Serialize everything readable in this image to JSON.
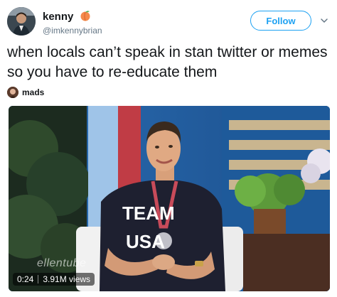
{
  "user": {
    "display_name": "kenny",
    "handle": "@imkennybrian"
  },
  "follow_label": "Follow",
  "tweet": {
    "text": "when locals can’t speak in stan twitter or memes so you have to re-educate them"
  },
  "quote": {
    "name": "mads"
  },
  "video": {
    "time": "0:24",
    "views": "3.91M views",
    "watermark": "ellentube",
    "shirt_text_top": "TEAM",
    "shirt_text_bottom": "USA"
  },
  "colors": {
    "accent": "#1da1f2",
    "text": "#14171a",
    "secondary": "#657786"
  }
}
